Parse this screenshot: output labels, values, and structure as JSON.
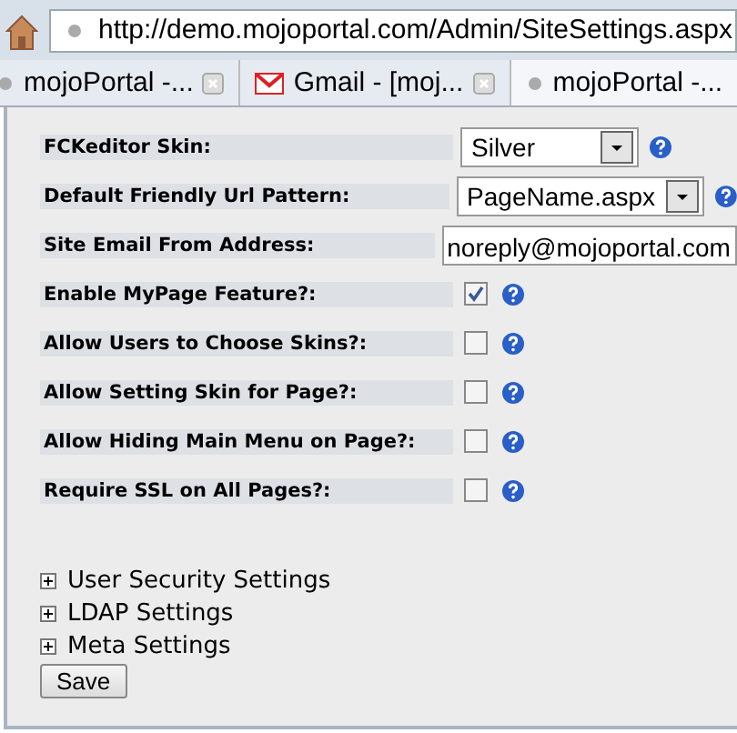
{
  "address_bar": {
    "url": "http://demo.mojoportal.com/Admin/SiteSettings.aspx"
  },
  "tabs": [
    {
      "label": "mojoPortal -...",
      "kind": "page",
      "closable": true,
      "selected": false
    },
    {
      "label": "Gmail - [moj...",
      "kind": "mail",
      "closable": true,
      "selected": false
    },
    {
      "label": "mojoPortal -...",
      "kind": "page",
      "closable": false,
      "selected": true
    }
  ],
  "settings": [
    {
      "label": "FCKeditor Skin:",
      "kind": "select",
      "value": "Silver"
    },
    {
      "label": "Default Friendly Url Pattern:",
      "kind": "select",
      "value": "PageName.aspx"
    },
    {
      "label": "Site Email From Address:",
      "kind": "text",
      "value": "noreply@mojoportal.com"
    },
    {
      "label": "Enable MyPage Feature?:",
      "kind": "checkbox",
      "checked": true
    },
    {
      "label": "Allow Users to Choose Skins?:",
      "kind": "checkbox",
      "checked": false
    },
    {
      "label": "Allow Setting Skin for Page?:",
      "kind": "checkbox",
      "checked": false
    },
    {
      "label": "Allow Hiding Main Menu on Page?:",
      "kind": "checkbox",
      "checked": false
    },
    {
      "label": "Require SSL on All Pages?:",
      "kind": "checkbox",
      "checked": false
    }
  ],
  "sections": [
    {
      "label": "User Security Settings",
      "expanded": false
    },
    {
      "label": "LDAP Settings",
      "expanded": false
    },
    {
      "label": "Meta Settings",
      "expanded": false
    }
  ],
  "save_button": "Save"
}
